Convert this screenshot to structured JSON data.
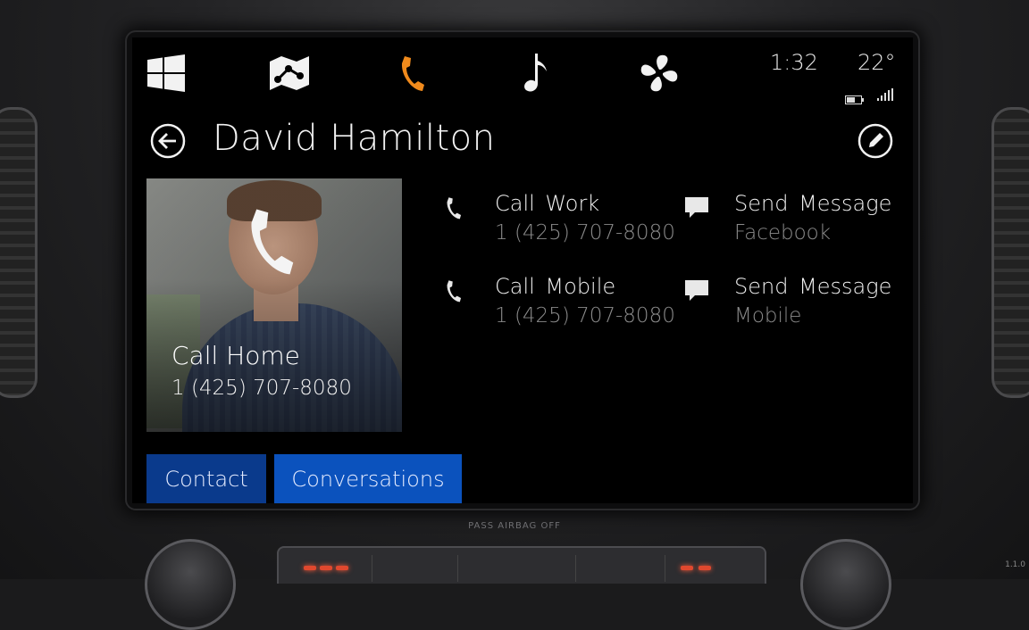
{
  "nav": {
    "icons": [
      "windows-icon",
      "map-icon",
      "phone-icon",
      "music-icon",
      "fan-icon"
    ],
    "active_index": 2,
    "accent_color": "#f08a1c"
  },
  "status": {
    "time": "1:32",
    "temperature": "22°",
    "battery_icon": "battery-icon",
    "signal_icon": "signal-icon"
  },
  "contact": {
    "name": "David Hamilton",
    "call_home": {
      "label": "Call  Home",
      "number": "1 (425) 707-8080"
    },
    "actions": [
      {
        "icon": "phone-icon",
        "label": "Call Work",
        "sub": "1 (425) 707-8080"
      },
      {
        "icon": "message-icon",
        "label": "Send  Message",
        "sub": "Facebook"
      },
      {
        "icon": "phone-icon",
        "label": "Call Mobile",
        "sub": "1 (425) 707-8080"
      },
      {
        "icon": "message-icon",
        "label": "Send  Message",
        "sub": "Mobile"
      }
    ]
  },
  "tabs": [
    {
      "label": "Contact",
      "color": "#0a3a8c"
    },
    {
      "label": "Conversations",
      "color": "#0b52bd"
    }
  ],
  "dashboard": {
    "airbag_text": "PASS AIRBAG  OFF",
    "version": "1.1.0"
  }
}
